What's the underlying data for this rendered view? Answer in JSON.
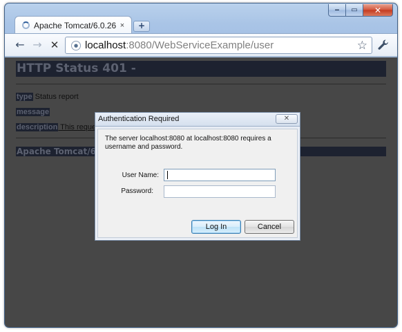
{
  "window": {
    "caption": {
      "minimize": "‒",
      "maximize": "▭",
      "close": "✕"
    }
  },
  "tab": {
    "title": "Apache Tomcat/6.0.26 - ...",
    "close_glyph": "×",
    "new_tab_glyph": "+"
  },
  "toolbar": {
    "back_glyph": "←",
    "forward_glyph": "→",
    "stop_glyph": "✕",
    "url_host": "localhost",
    "url_rest": ":8080/WebServiceExample/user",
    "star_glyph": "☆",
    "wrench_glyph": "🔧"
  },
  "page": {
    "heading": "HTTP Status 401 -",
    "type_label": "type",
    "type_value": " Status report",
    "message_label": "message",
    "description_label": "description",
    "description_value": " This reques",
    "footer": "Apache Tomcat/6.0"
  },
  "dialog": {
    "title": "Authentication Required",
    "close_glyph": "✕",
    "message": "The server localhost:8080 at localhost:8080 requires a username and password.",
    "username_label": "User Name:",
    "username_value": "",
    "password_label": "Password:",
    "password_value": "",
    "login_button": "Log In",
    "cancel_button": "Cancel"
  },
  "icons": {
    "loading": "tab-loading-spinner-icon",
    "page": "page-globe-icon",
    "star": "bookmark-star-icon",
    "wrench": "wrench-icon"
  }
}
